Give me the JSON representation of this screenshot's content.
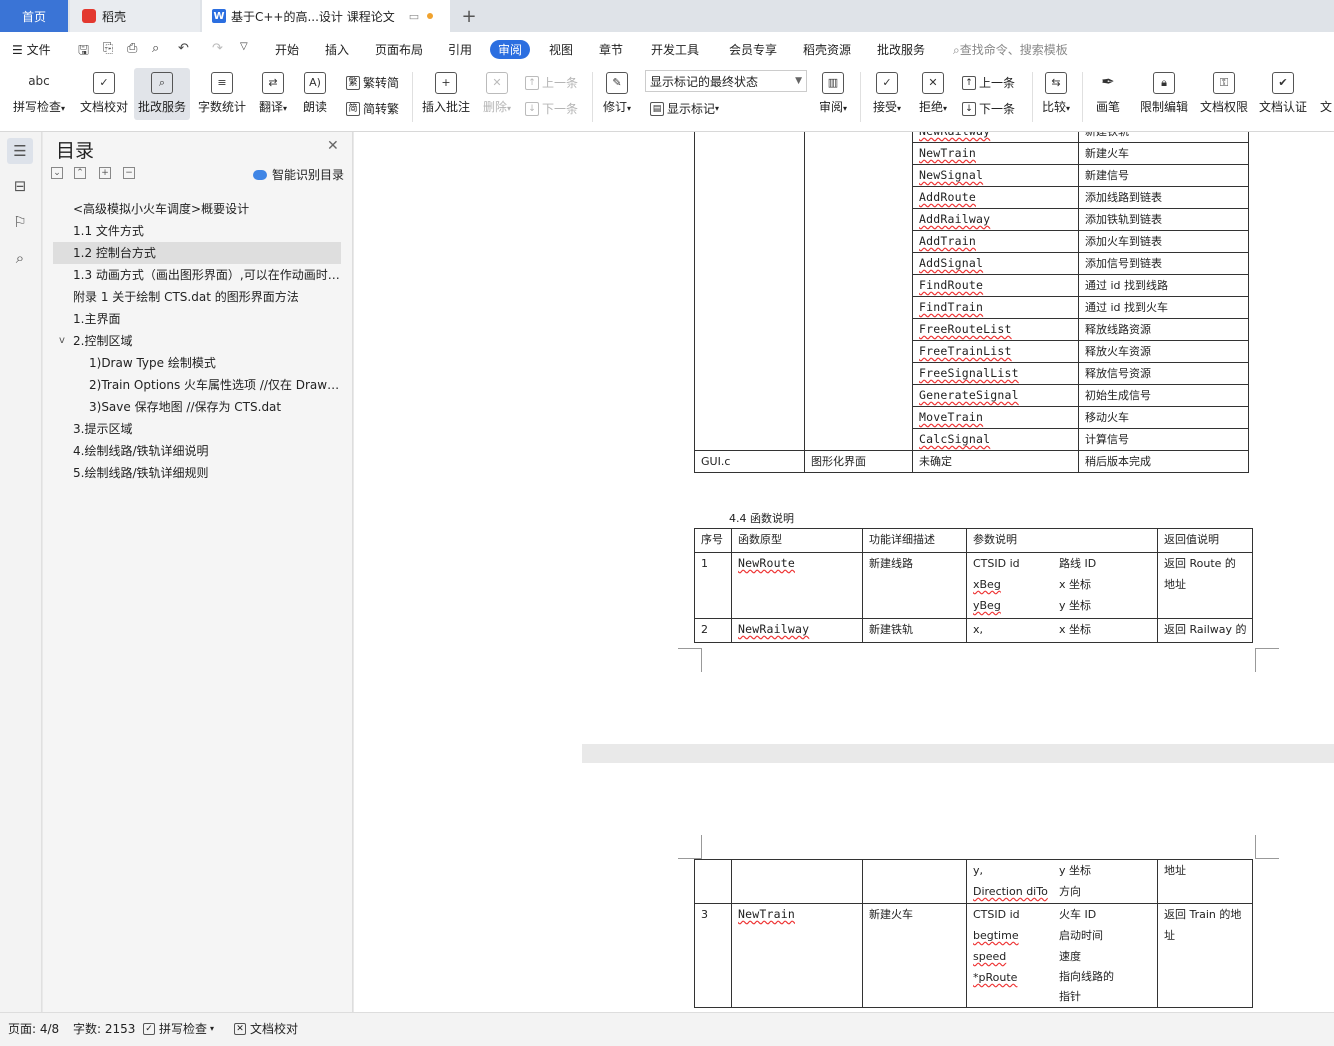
{
  "tabs": {
    "home": "首页",
    "daoke": "稻壳",
    "document": "基于C++的高...设计 课程论文"
  },
  "menu": [
    "文件",
    "开始",
    "插入",
    "页面布局",
    "引用",
    "审阅",
    "视图",
    "章节",
    "开发工具",
    "会员专享",
    "稻壳资源",
    "批改服务"
  ],
  "search_placeholder": "查找命令、搜索模板",
  "toolbar": {
    "spell": "拼写检查",
    "proofread": "文档校对",
    "correction": "批改服务",
    "wordcount": "字数统计",
    "translate": "翻译",
    "read": "朗读",
    "to_simplified": "繁转简",
    "to_traditional": "简转繁",
    "insert_comment": "插入批注",
    "delete": "删除",
    "prev": "上一条",
    "next": "下一条",
    "track": "修订",
    "markup_state": "显示标记的最终状态",
    "show_markup": "显示标记",
    "review": "审阅",
    "accept": "接受",
    "reject": "拒绝",
    "prev2": "上一条",
    "next2": "下一条",
    "compare": "比较",
    "pen": "画笔",
    "restrict": "限制编辑",
    "permission": "文档权限",
    "certify": "文档认证",
    "more": "文"
  },
  "toc": {
    "title": "目录",
    "smart": "智能识别目录",
    "items": [
      "<高级模拟小火车调度>概要设计",
      "1.1  文件方式",
      "1.2  控制台方式",
      "1.3  动画方式（画出图形界面）,可以在作动画时人工控制",
      "附录 1 关于绘制 CTS.dat 的图形界面方法",
      "1.主界面",
      "2.控制区域",
      "1)Draw Type 绘制模式",
      "2)Train Options  火车属性选项    //仅在 Draw Type 为 Train 时",
      "3)Save  保存地图    //保存为 CTS.dat",
      "3.提示区域",
      "4.绘制线路/铁轨详细说明",
      "5.绘制线路/铁轨详细规则"
    ]
  },
  "table1": {
    "rows": [
      [
        "NewRailway",
        "新建铁轨"
      ],
      [
        "NewTrain",
        "新建火车"
      ],
      [
        "NewSignal",
        "新建信号"
      ],
      [
        "AddRoute",
        "添加线路到链表"
      ],
      [
        "AddRailway",
        "添加铁轨到链表"
      ],
      [
        "AddTrain",
        "添加火车到链表"
      ],
      [
        "AddSignal",
        "添加信号到链表"
      ],
      [
        "FindRoute",
        "通过 id 找到线路"
      ],
      [
        "FindTrain",
        "通过 id 找到火车"
      ],
      [
        "FreeRouteList",
        "释放线路资源"
      ],
      [
        "FreeTrainList",
        "释放火车资源"
      ],
      [
        "FreeSignalList",
        "释放信号资源"
      ],
      [
        "GenerateSignal",
        "初始生成信号"
      ],
      [
        "MoveTrain",
        "移动火车"
      ],
      [
        "CalcSignal",
        "计算信号"
      ]
    ],
    "last": [
      "GUI.c",
      "图形化界面",
      "未确定",
      "稍后版本完成"
    ]
  },
  "section": "4.4  函数说明",
  "table2": {
    "headers": [
      "序号",
      "函数原型",
      "功能详细描述",
      "参数说明",
      "返回值说明"
    ],
    "row1": {
      "no": "1",
      "fn": "NewRoute",
      "desc": "新建线路",
      "params": [
        [
          "CTSID id",
          "路线 ID"
        ],
        [
          "xBeg",
          "x 坐标"
        ],
        [
          "yBeg",
          "y 坐标"
        ]
      ],
      "ret": "返回 Route 的地址"
    },
    "row2": {
      "no": "2",
      "fn": "NewRailway",
      "desc": "新建铁轨",
      "params": [
        [
          "x,",
          "x 坐标"
        ]
      ],
      "ret": "返回 Railway 的"
    }
  },
  "table3": {
    "row0": {
      "params": [
        [
          "y,",
          "y 坐标"
        ],
        [
          "Direction diTo",
          "方向"
        ]
      ],
      "ret": "地址"
    },
    "row1": {
      "no": "3",
      "fn": "NewTrain",
      "desc": "新建火车",
      "params": [
        [
          "CTSID id",
          "火车 ID"
        ],
        [
          "begtime",
          "启动时间"
        ],
        [
          "speed",
          "速度"
        ],
        [
          "*pRoute",
          "指向线路的指针"
        ]
      ],
      "ret": "返回 Train 的地址"
    }
  },
  "status": {
    "page": "页面: 4/8",
    "words": "字数: 2153",
    "spell": "拼写检查",
    "proof": "文档校对"
  }
}
